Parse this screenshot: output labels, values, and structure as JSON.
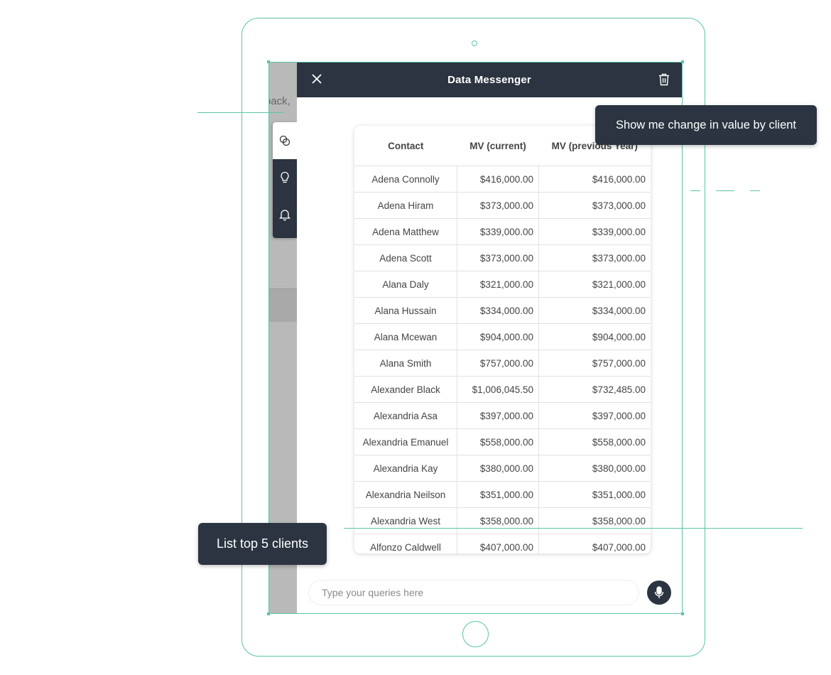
{
  "background_app": {
    "partial_text": "back,"
  },
  "side_tabs": [
    {
      "name": "chat",
      "active": true
    },
    {
      "name": "explore-queries",
      "active": false
    },
    {
      "name": "notifications",
      "active": false
    }
  ],
  "header": {
    "title": "Data Messenger"
  },
  "table": {
    "columns": [
      "Contact",
      "MV (current)",
      "MV (previous Year)"
    ],
    "rows": [
      [
        "Adena  Connolly",
        "$416,000.00",
        "$416,000.00"
      ],
      [
        "Adena  Hiram",
        "$373,000.00",
        "$373,000.00"
      ],
      [
        "Adena  Matthew",
        "$339,000.00",
        "$339,000.00"
      ],
      [
        "Adena  Scott",
        "$373,000.00",
        "$373,000.00"
      ],
      [
        "Alana Daly",
        "$321,000.00",
        "$321,000.00"
      ],
      [
        "Alana Hussain",
        "$334,000.00",
        "$334,000.00"
      ],
      [
        "Alana Mcewan",
        "$904,000.00",
        "$904,000.00"
      ],
      [
        "Alana Smith",
        "$757,000.00",
        "$757,000.00"
      ],
      [
        "Alexander Black",
        "$1,006,045.50",
        "$732,485.00"
      ],
      [
        "Alexandria Asa",
        "$397,000.00",
        "$397,000.00"
      ],
      [
        "Alexandria Emanuel",
        "$558,000.00",
        "$558,000.00"
      ],
      [
        "Alexandria Kay",
        "$380,000.00",
        "$380,000.00"
      ],
      [
        "Alexandria Neilson",
        "$351,000.00",
        "$351,000.00"
      ],
      [
        "Alexandria West",
        "$358,000.00",
        "$358,000.00"
      ],
      [
        "Alfonzo  Caldwell",
        "$407,000.00",
        "$407,000.00"
      ]
    ]
  },
  "input": {
    "placeholder": "Type your queries here",
    "value": ""
  },
  "callouts": {
    "right": "Show me change in value by client",
    "left": "List top 5 clients"
  },
  "colors": {
    "accent_line": "#5cc3a8",
    "dark": "#2b3440"
  }
}
